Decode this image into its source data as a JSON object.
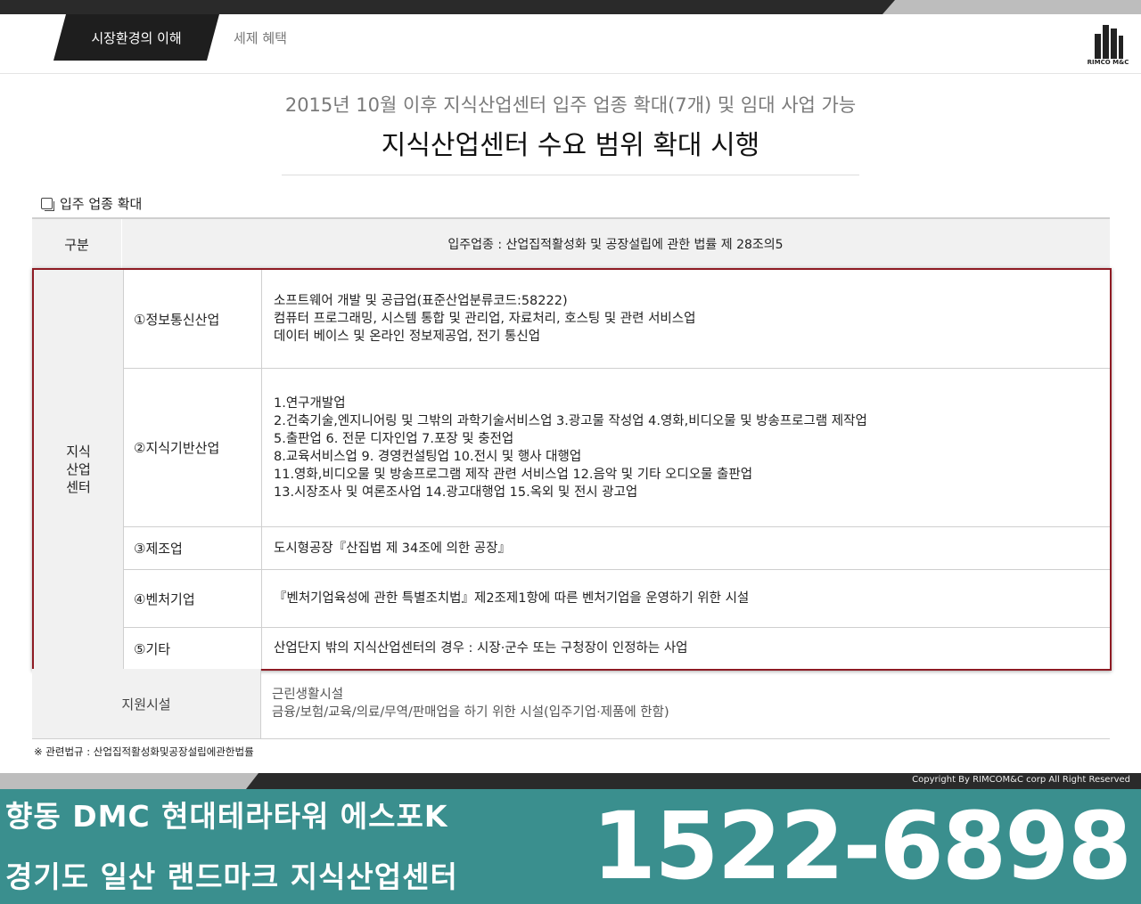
{
  "header": {
    "tab_active": "시장환경의 이해",
    "tab_inactive": "세제 혜택",
    "logo_text": "RIMCO M&C"
  },
  "main": {
    "subtitle": "2015년 10월 이후 지식산업센터 입주 업종 확대(7개) 및 임대 사업 가능",
    "title": "지식산업센터 수요 범위 확대 시행",
    "section_label": "입주 업종 확대"
  },
  "table": {
    "header_col1": "구분",
    "header_col2": "입주업종 : 산업집적활성화 및 공장설립에 관한 법률 제 28조의5",
    "group_label": [
      "지식",
      "산업",
      "센터"
    ],
    "rows": [
      {
        "name": "①정보통신산업",
        "lines": [
          "소프트웨어 개발 및 공급업(표준산업분류코드:58222)",
          "컴퓨터 프로그래밍, 시스템 통합 및 관리업, 자료처리, 호스팅 및 관련 서비스업",
          "데이터 베이스 및 온라인 정보제공업, 전기 통신업"
        ]
      },
      {
        "name": "②지식기반산업",
        "lines": [
          "1.연구개발업",
          "2.건축기술,엔지니어링 및 그밖의 과학기술서비스업  3.광고물 작성업  4.영화,비디오물 및 방송프로그램 제작업",
          "5.출판업  6. 전문 디자인업  7.포장 및 충전업",
          "8.교육서비스업 9. 경영컨설팅업  10.전시 및 행사 대행업",
          "11.영화,비디오물 및 방송프로그램 제작 관련 서비스업 12.음악 및 기타 오디오물 출판업",
          "13.시장조사 및 여론조사업 14.광고대행업 15.옥외 및 전시 광고업"
        ]
      },
      {
        "name": "③제조업",
        "lines": [
          "도시형공장『산집법 제 34조에 의한 공장』"
        ]
      },
      {
        "name": "④벤처기업",
        "lines": [
          "『벤처기업육성에 관한 특별조치법』제2조제1항에 따른 벤처기업을 운영하기 위한 시설"
        ]
      },
      {
        "name": "⑤기타",
        "lines": [
          "산업단지 밖의 지식산업센터의 경우 : 시장·군수 또는 구청장이 인정하는 사업"
        ]
      }
    ],
    "support_label": "지원시설",
    "support_lines": [
      "근린생활시설",
      "금융/보험/교육/의료/무역/판매업을 하기 위한 시설(입주기업·제품에 한함)"
    ]
  },
  "note": "※ 관련법규 : 산업집적활성화및공장설립에관한법률",
  "footer": {
    "copyright": "Copyright By RIMCOM&C corp All Right Reserved",
    "banner_line1": "향동 DMC 현대테라타워 에스포K",
    "banner_line2": "경기도 일산 랜드마크 지식산업센터",
    "phone": "1522-6898"
  },
  "colors": {
    "accent_red": "#8e1b24",
    "banner_teal": "#3a8f8e",
    "dark": "#1e1e1e"
  }
}
